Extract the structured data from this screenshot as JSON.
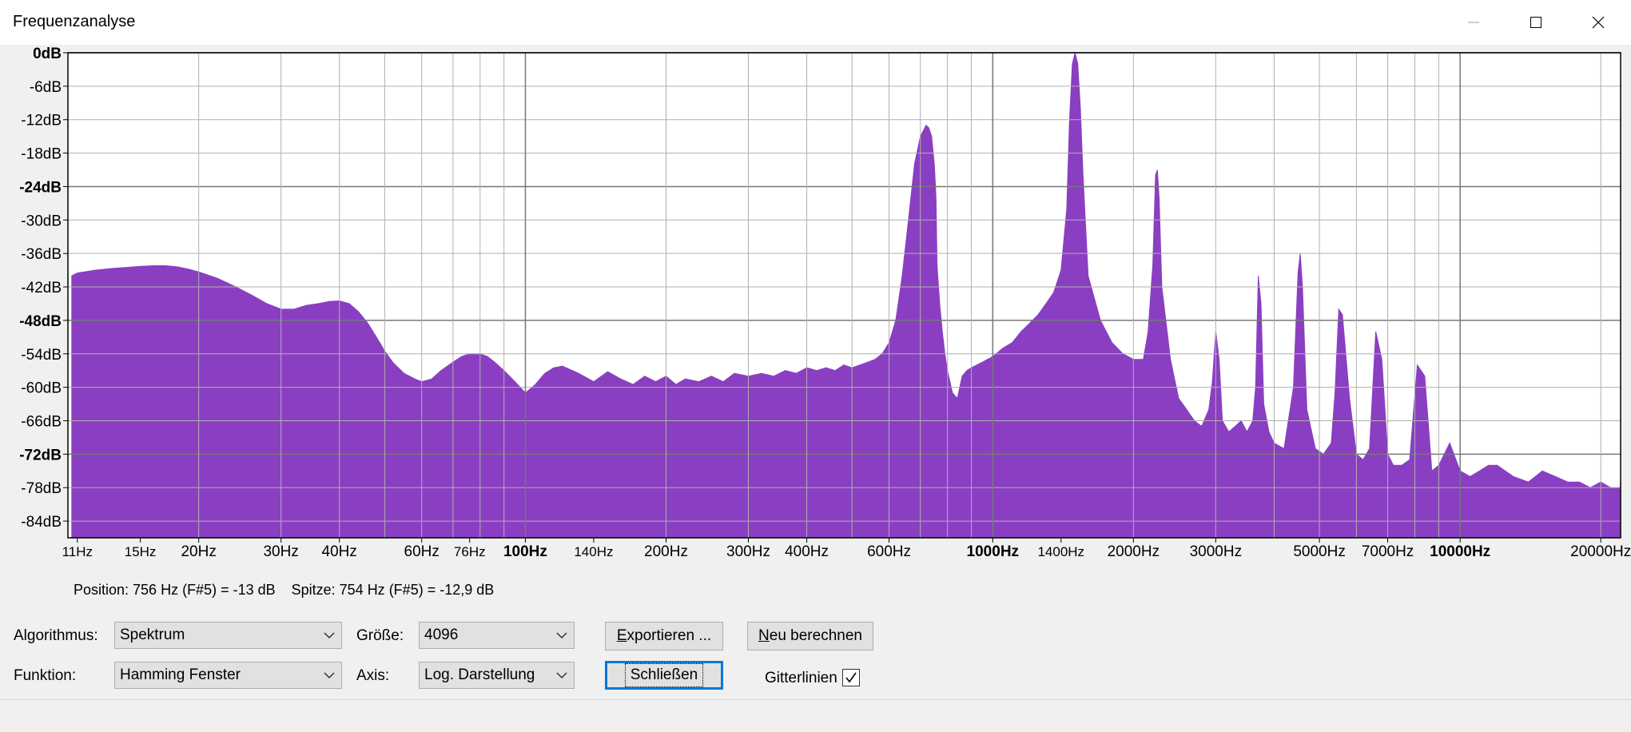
{
  "window": {
    "title": "Frequenzanalyse"
  },
  "chart_data": {
    "type": "area",
    "x_scale": "log",
    "xlim": [
      10.5,
      22050
    ],
    "ylim": [
      -87,
      0
    ],
    "grid": true,
    "fill_color": "#8a3fc2",
    "y_ticks": [
      {
        "label": "0dB",
        "value": 0,
        "bold": true
      },
      {
        "label": "-6dB",
        "value": -6,
        "bold": false
      },
      {
        "label": "-12dB",
        "value": -12,
        "bold": false
      },
      {
        "label": "-18dB",
        "value": -18,
        "bold": false
      },
      {
        "label": "-24dB",
        "value": -24,
        "bold": true
      },
      {
        "label": "-30dB",
        "value": -30,
        "bold": false
      },
      {
        "label": "-36dB",
        "value": -36,
        "bold": false
      },
      {
        "label": "-42dB",
        "value": -42,
        "bold": false
      },
      {
        "label": "-48dB",
        "value": -48,
        "bold": true
      },
      {
        "label": "-54dB",
        "value": -54,
        "bold": false
      },
      {
        "label": "-60dB",
        "value": -60,
        "bold": false
      },
      {
        "label": "-66dB",
        "value": -66,
        "bold": false
      },
      {
        "label": "-72dB",
        "value": -72,
        "bold": true
      },
      {
        "label": "-78dB",
        "value": -78,
        "bold": false
      },
      {
        "label": "-84dB",
        "value": -84,
        "bold": false
      }
    ],
    "x_tick_labels": [
      {
        "label": "11Hz",
        "value": 11,
        "size": "small"
      },
      {
        "label": "15Hz",
        "value": 15,
        "size": "small"
      },
      {
        "label": "20Hz",
        "value": 20,
        "size": "normal"
      },
      {
        "label": "30Hz",
        "value": 30,
        "size": "normal"
      },
      {
        "label": "40Hz",
        "value": 40,
        "size": "normal"
      },
      {
        "label": "60Hz",
        "value": 60,
        "size": "normal"
      },
      {
        "label": "76Hz",
        "value": 76,
        "size": "small"
      },
      {
        "label": "100Hz",
        "value": 100,
        "size": "bold"
      },
      {
        "label": "140Hz",
        "value": 140,
        "size": "small"
      },
      {
        "label": "200Hz",
        "value": 200,
        "size": "normal"
      },
      {
        "label": "300Hz",
        "value": 300,
        "size": "normal"
      },
      {
        "label": "400Hz",
        "value": 400,
        "size": "normal"
      },
      {
        "label": "600Hz",
        "value": 600,
        "size": "normal"
      },
      {
        "label": "1000Hz",
        "value": 1000,
        "size": "bold"
      },
      {
        "label": "1400Hz",
        "value": 1400,
        "size": "small"
      },
      {
        "label": "2000Hz",
        "value": 2000,
        "size": "normal"
      },
      {
        "label": "3000Hz",
        "value": 3000,
        "size": "normal"
      },
      {
        "label": "5000Hz",
        "value": 5000,
        "size": "normal"
      },
      {
        "label": "7000Hz",
        "value": 7000,
        "size": "normal"
      },
      {
        "label": "10000Hz",
        "value": 10000,
        "size": "bold"
      },
      {
        "label": "20000Hz",
        "value": 20000,
        "size": "normal"
      }
    ],
    "x_gridlines": [
      20,
      30,
      40,
      50,
      60,
      70,
      80,
      90,
      100,
      200,
      300,
      400,
      500,
      600,
      700,
      800,
      900,
      1000,
      2000,
      3000,
      4000,
      5000,
      6000,
      7000,
      8000,
      9000,
      10000,
      20000
    ],
    "x_gridlines_bold": [
      100,
      1000,
      10000
    ],
    "x": [
      10.7,
      11,
      12,
      13,
      14,
      15,
      16,
      17,
      18,
      19,
      20,
      22,
      24,
      26,
      28,
      30,
      32,
      34,
      36,
      38,
      40,
      42,
      44,
      46,
      48,
      50,
      52,
      55,
      58,
      60,
      63,
      66,
      70,
      73,
      76,
      80,
      83,
      86,
      90,
      95,
      100,
      105,
      110,
      115,
      120,
      130,
      140,
      150,
      160,
      170,
      180,
      190,
      200,
      210,
      220,
      235,
      250,
      265,
      280,
      300,
      320,
      340,
      360,
      380,
      400,
      420,
      440,
      460,
      480,
      500,
      520,
      540,
      560,
      580,
      600,
      620,
      640,
      660,
      680,
      700,
      710,
      720,
      730,
      740,
      750,
      756,
      760,
      770,
      780,
      790,
      800,
      820,
      840,
      860,
      880,
      900,
      950,
      1000,
      1050,
      1100,
      1150,
      1200,
      1250,
      1300,
      1350,
      1400,
      1440,
      1460,
      1480,
      1500,
      1520,
      1540,
      1560,
      1600,
      1700,
      1800,
      1900,
      2000,
      2100,
      2150,
      2200,
      2230,
      2250,
      2270,
      2300,
      2400,
      2500,
      2600,
      2700,
      2800,
      2900,
      2950,
      3000,
      3050,
      3100,
      3200,
      3300,
      3400,
      3500,
      3600,
      3650,
      3700,
      3750,
      3800,
      3900,
      4000,
      4200,
      4400,
      4500,
      4550,
      4600,
      4700,
      4900,
      5100,
      5300,
      5400,
      5500,
      5600,
      5800,
      6000,
      6200,
      6400,
      6600,
      6800,
      7000,
      7200,
      7500,
      7800,
      8100,
      8400,
      8700,
      9000,
      9500,
      10000,
      10500,
      11000,
      11500,
      12000,
      13000,
      14000,
      15000,
      16000,
      17000,
      18000,
      19000,
      20000,
      21000,
      22000
    ],
    "y": [
      -40,
      -39.5,
      -39,
      -38.7,
      -38.5,
      -38.3,
      -38.2,
      -38.2,
      -38.4,
      -38.8,
      -39.3,
      -40.5,
      -42,
      -43.5,
      -45,
      -46,
      -46,
      -45.3,
      -45,
      -44.6,
      -44.5,
      -45,
      -46.5,
      -48.5,
      -51,
      -53.5,
      -55.5,
      -57.5,
      -58.5,
      -59,
      -58.5,
      -57,
      -55.5,
      -54.5,
      -54,
      -54,
      -54.5,
      -55.5,
      -57,
      -59,
      -61,
      -59.5,
      -57.5,
      -56.5,
      -56.2,
      -57.5,
      -59,
      -57.2,
      -58.5,
      -59.5,
      -58,
      -59,
      -58,
      -59.5,
      -58.5,
      -59,
      -58,
      -59,
      -57.5,
      -58,
      -57.5,
      -58,
      -57,
      -57.5,
      -56.5,
      -57,
      -56.5,
      -57,
      -56,
      -56.5,
      -56,
      -55.5,
      -55,
      -54,
      -52,
      -48,
      -40,
      -30,
      -20,
      -15,
      -14,
      -13,
      -13.5,
      -15,
      -20,
      -26,
      -38,
      -45,
      -50,
      -54,
      -57,
      -61,
      -62,
      -58,
      -57,
      -56.5,
      -55.5,
      -54.5,
      -53,
      -52,
      -50,
      -48.5,
      -47,
      -45,
      -43,
      -39,
      -28,
      -12,
      -2,
      0,
      -2,
      -10,
      -22,
      -40,
      -48,
      -52,
      -54,
      -55,
      -55,
      -50,
      -38,
      -22,
      -21,
      -26,
      -42,
      -55,
      -62,
      -64,
      -66,
      -67,
      -64,
      -59,
      -50,
      -55,
      -66,
      -68,
      -67,
      -66,
      -68,
      -66,
      -60,
      -40,
      -45,
      -63,
      -68,
      -70,
      -71,
      -60,
      -39.5,
      -36,
      -42,
      -64,
      -71,
      -72,
      -70,
      -61,
      -46,
      -47,
      -62,
      -72,
      -73,
      -71,
      -50,
      -55,
      -72,
      -74,
      -74,
      -73,
      -56,
      -58,
      -75,
      -74,
      -70,
      -75,
      -76,
      -75,
      -74,
      -74,
      -76,
      -77,
      -75,
      -76,
      -77,
      -77,
      -78,
      -77,
      -78,
      -78,
      -79,
      -78,
      -77
    ]
  },
  "status": {
    "position": "Position: 756 Hz (F#5) = -13 dB",
    "peak": "Spitze: 754 Hz (F#5) = -12,9 dB"
  },
  "controls": {
    "algorithm_label": "Algorithmus:",
    "algorithm_value": "Spektrum",
    "function_label": "Funktion:",
    "function_value": "Hamming Fenster",
    "size_label": "Größe:",
    "size_value": "4096",
    "axis_label": "Axis:",
    "axis_value": "Log. Darstellung",
    "export_label": "Exportieren ...",
    "recalc_label": "Neu berechnen",
    "close_label": "Schließen",
    "gridlines_label": "Gitterlinien",
    "gridlines_checked": true
  }
}
